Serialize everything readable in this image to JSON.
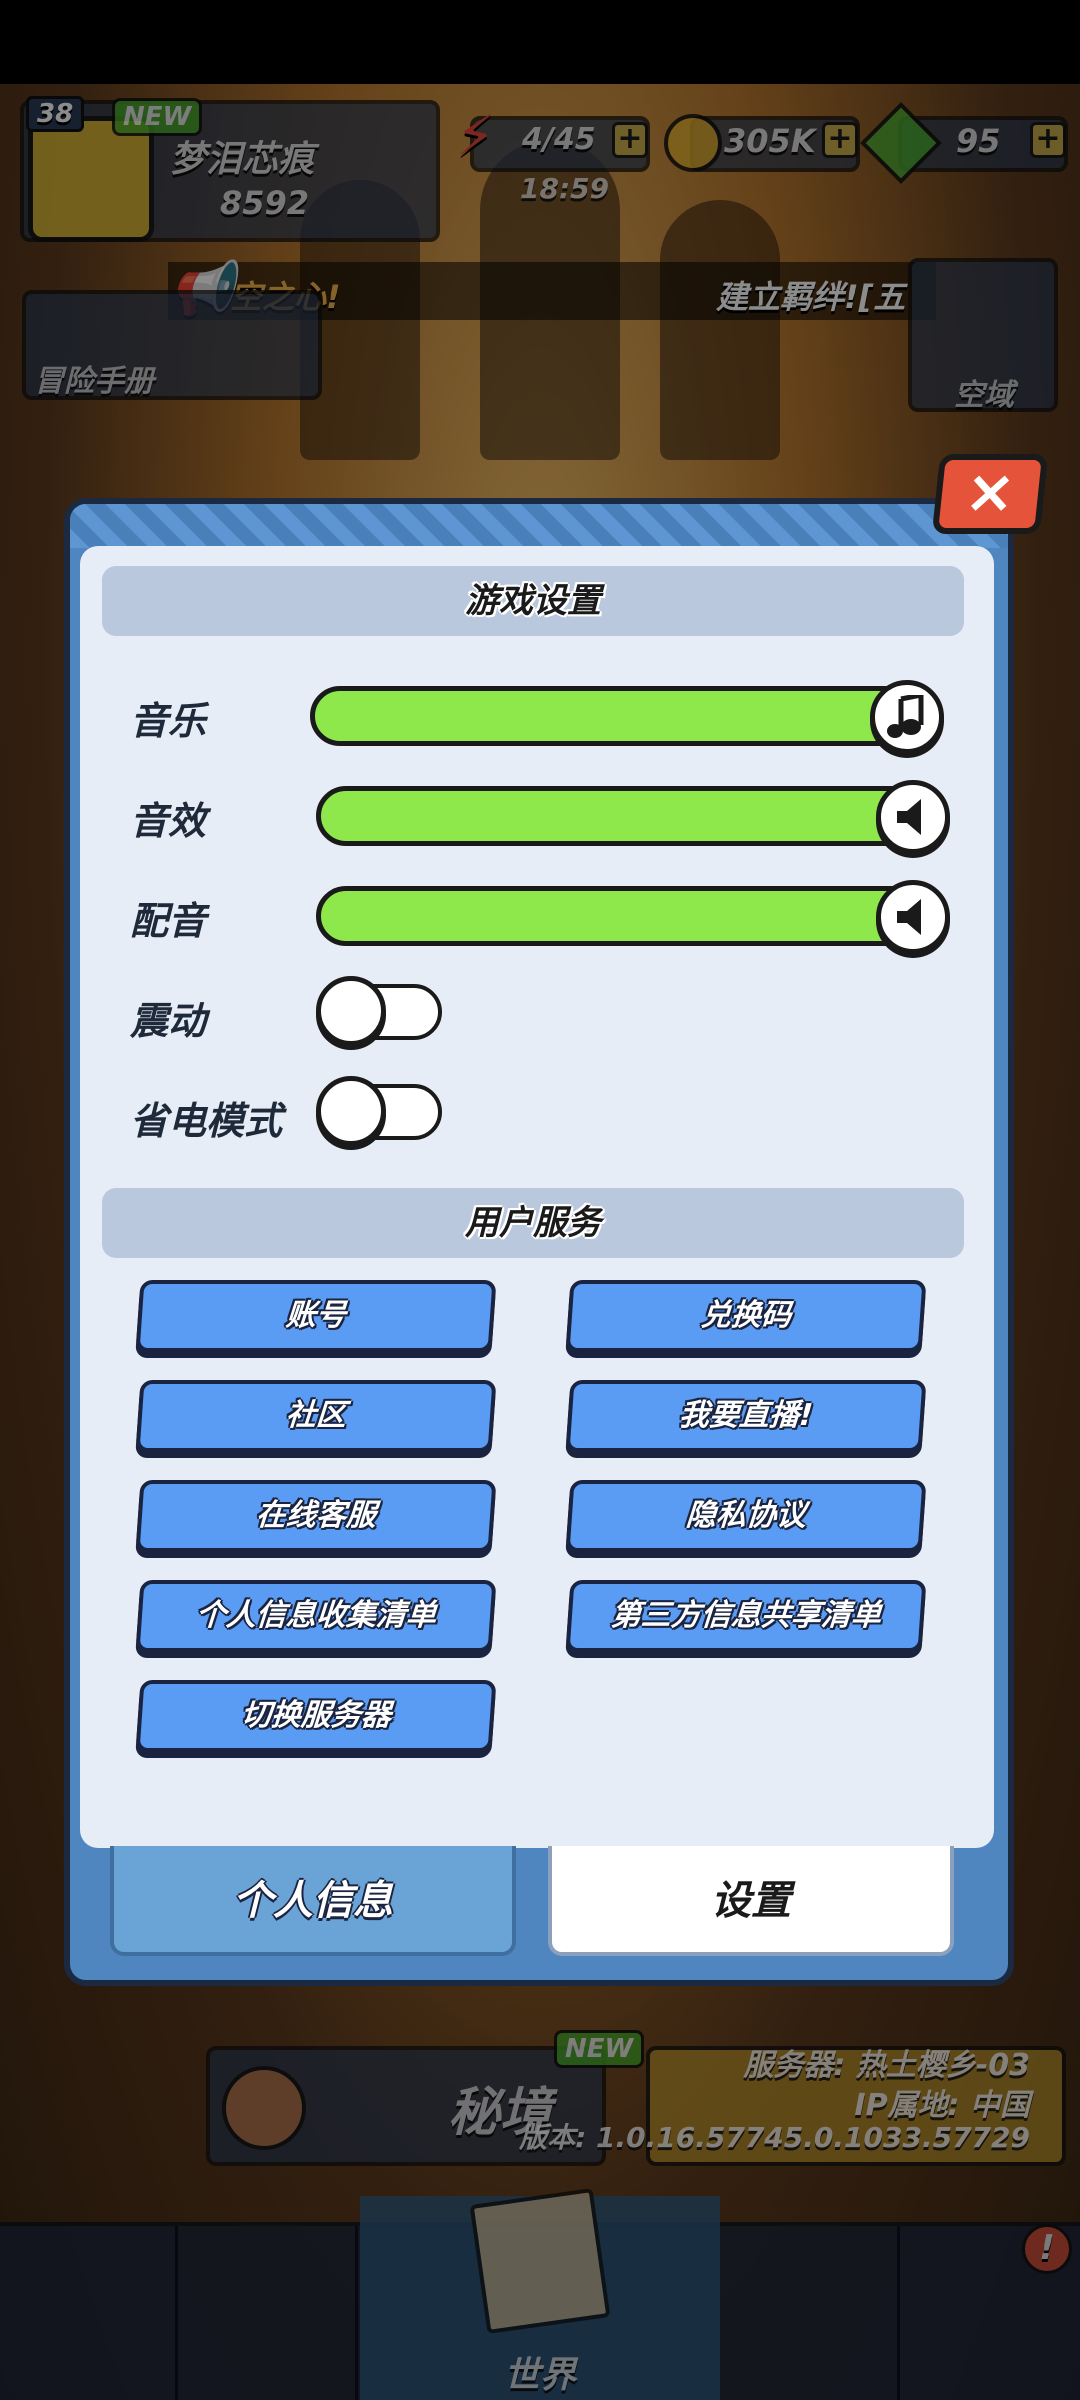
{
  "hud": {
    "level": "38",
    "new_badge": "NEW",
    "player_name": "梦泪芯痕",
    "power": "8592",
    "energy": "4/45",
    "energy_timer": "18:59",
    "coins": "305K",
    "gems": "95",
    "plus": "+"
  },
  "ticker": {
    "left_text": "空之心!",
    "right_text": "建立羁绊![五"
  },
  "side_buttons": {
    "adventure_book": "冒险手册",
    "sky_domain": "空域"
  },
  "dialog": {
    "close_label": "×",
    "game_settings": {
      "title": "游戏设置",
      "music_label": "音乐",
      "music_level": 1.0,
      "sfx_label": "音效",
      "sfx_level": 1.0,
      "voice_label": "配音",
      "voice_level": 1.0,
      "vibration_label": "震动",
      "vibration_on": false,
      "power_saving_label": "省电模式",
      "power_saving_on": false
    },
    "user_services": {
      "title": "用户服务",
      "buttons": [
        "账号",
        "兑换码",
        "社区",
        "我要直播!",
        "在线客服",
        "隐私协议",
        "个人信息收集清单",
        "第三方信息共享清单",
        "切换服务器"
      ]
    },
    "tabs": {
      "profile": "个人信息",
      "settings": "设置"
    }
  },
  "background": {
    "secret_realm": "秘境",
    "new_badge": "NEW",
    "server": "服务器: 热土樱乡-03",
    "ip_location": "IP属地: 中国",
    "version": "版本: 1.0.16.57745.0.1033.57729",
    "world_label": "世界"
  },
  "colors": {
    "slider_fill": "#8ee84c",
    "button_blue": "#5a9cf3",
    "close_red": "#e5543a",
    "dialog_frame": "#4f86c0"
  }
}
